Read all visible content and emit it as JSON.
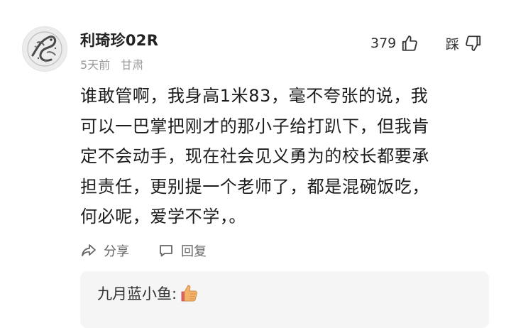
{
  "comment": {
    "username": "利琦珍02R",
    "time": "5天前",
    "location": "甘肃",
    "like_count": "379",
    "dislike_label": "踩",
    "body_lines": [
      "谁敢管啊，我身高1米83，毫不夸张的说，我",
      "可以一巴掌把刚才的那小子给打趴下，但我肯",
      "定不会动手，现在社会见义勇为的校长都要承",
      "担责任，更别提一个老师了，都是混碗饭吃，",
      "何必呢，爱学不学，。"
    ],
    "share_label": "分享",
    "reply_label": "回复"
  },
  "reply_preview": {
    "author": "九月蓝小鱼:",
    "emoji": "thumbs-up-emoji"
  },
  "colors": {
    "text_primary": "#1c1c1c",
    "text_meta": "#9b9b9b",
    "action_text": "#666666",
    "reply_bg": "#f5f5f5",
    "emoji_fill": "#f6b26b"
  },
  "icons": {
    "like": "thumbs-up-icon",
    "dislike": "thumbs-down-icon",
    "share": "share-icon",
    "reply": "comment-bubble-icon"
  }
}
